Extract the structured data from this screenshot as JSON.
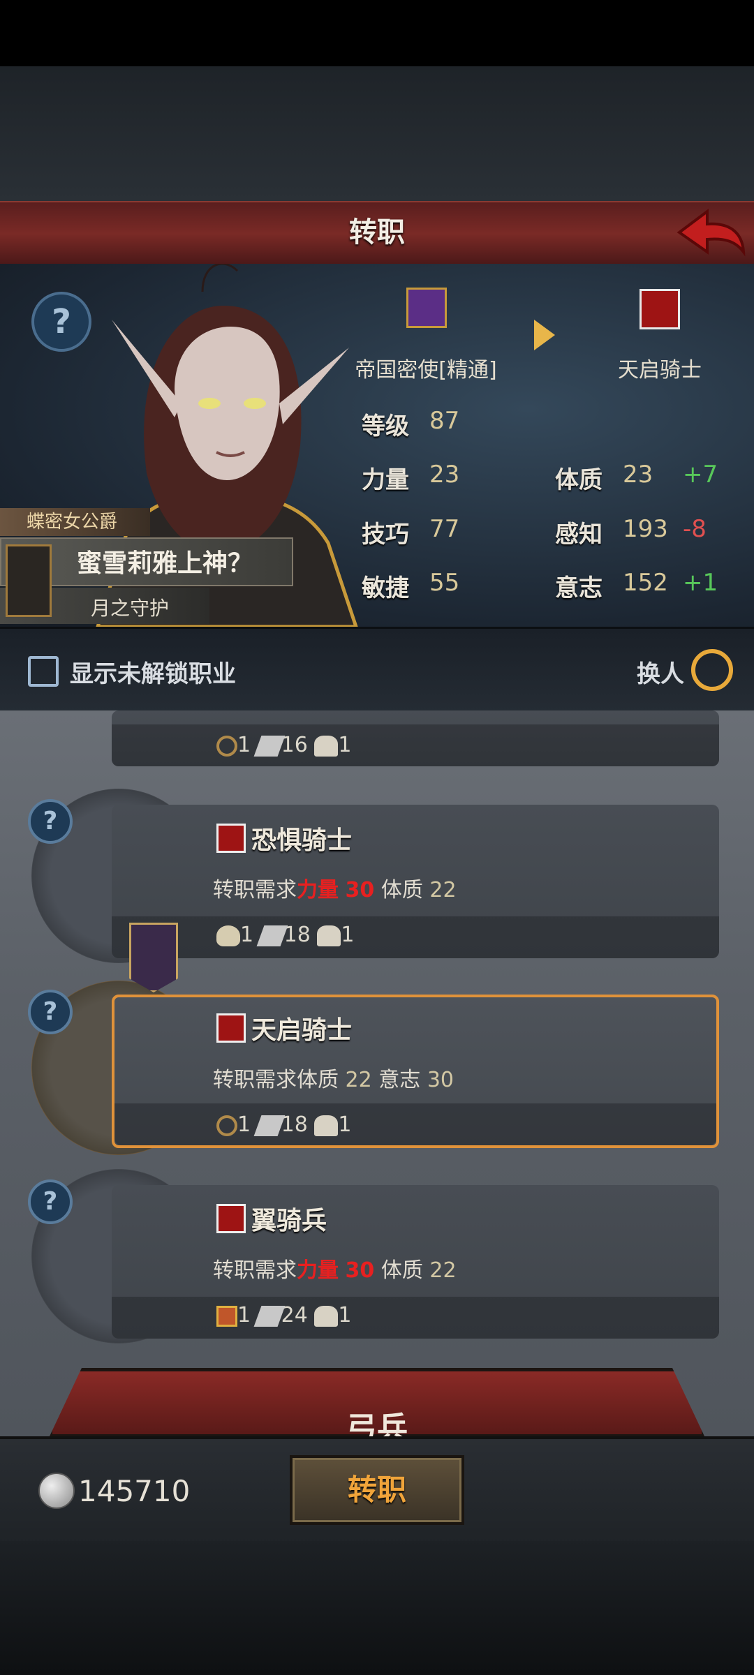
{
  "header": {
    "title": "转职"
  },
  "character": {
    "title_tag": "蝶密女公爵",
    "name": "蜜雪莉雅上神？",
    "subtitle": "月之守护",
    "current_class": "帝国密使[精通]",
    "target_class": "天启骑士",
    "help_symbol": "?"
  },
  "stats": {
    "level_label": "等级",
    "level": "87",
    "strength_label": "力量",
    "strength": "23",
    "skill_label": "技巧",
    "skill": "77",
    "agility_label": "敏捷",
    "agility": "55",
    "constitution_label": "体质",
    "constitution": "23",
    "constitution_delta": "+7",
    "perception_label": "感知",
    "perception": "193",
    "perception_delta": "-8",
    "will_label": "意志",
    "will": "152",
    "will_delta": "+1"
  },
  "filter": {
    "show_locked_label": "显示未解锁职业",
    "switch_label": "换人"
  },
  "jobs": [
    {
      "name": "",
      "partial": true,
      "cost": [
        "1",
        "16",
        "1"
      ]
    },
    {
      "name": "恐惧骑士",
      "req_prefix": "转职需求",
      "req1_label": "力量",
      "req1_value": "30",
      "req2_label": "体质",
      "req2_value": "22",
      "cost": [
        "1",
        "18",
        "1"
      ]
    },
    {
      "name": "天启骑士",
      "selected": true,
      "req_prefix": "转职需求",
      "req1_label": "体质",
      "req1_value": "22",
      "req2_label": "意志",
      "req2_value": "30",
      "cost": [
        "1",
        "18",
        "1"
      ]
    },
    {
      "name": "翼骑兵",
      "req_prefix": "转职需求",
      "req1_label": "力量",
      "req1_value": "30",
      "req2_label": "体质",
      "req2_value": "22",
      "cost": [
        "1",
        "24",
        "1"
      ]
    }
  ],
  "banner": {
    "label": "弓兵"
  },
  "footer": {
    "currency": "145710",
    "confirm_label": "转职"
  },
  "colors": {
    "accent": "#f0a43a",
    "title_bar": "#7a2a26",
    "requirement_unmet": "#e82020",
    "positive": "#58c85a",
    "negative": "#e05050"
  }
}
